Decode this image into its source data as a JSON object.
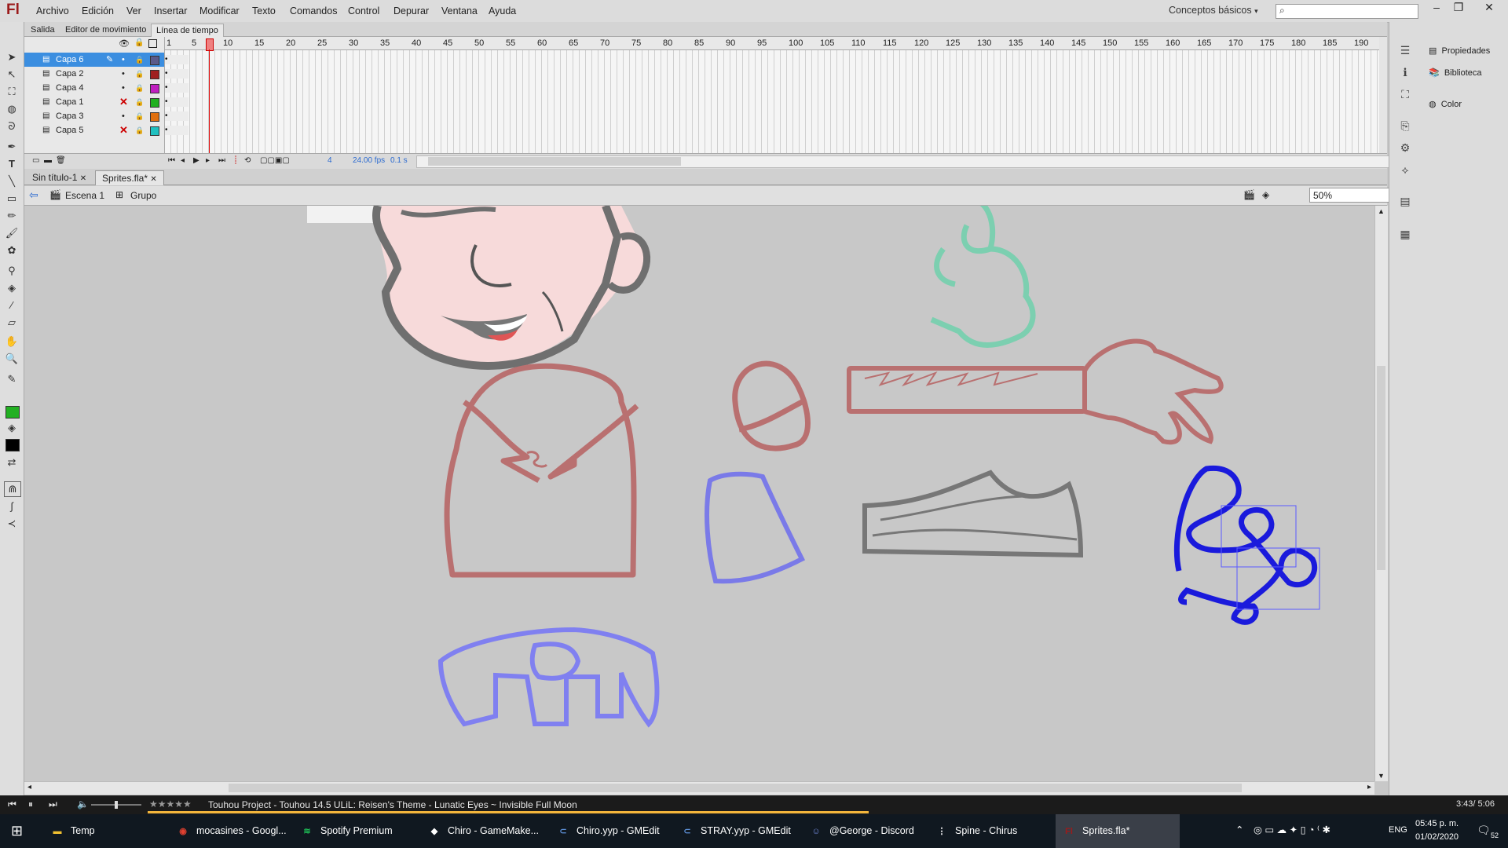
{
  "app": {
    "logo": "Fl",
    "menu": [
      "Archivo",
      "Edición",
      "Ver",
      "Insertar",
      "Modificar",
      "Texto",
      "Comandos",
      "Control",
      "Depurar",
      "Ventana",
      "Ayuda"
    ],
    "workspace": "Conceptos básicos",
    "search_placeholder": ""
  },
  "panel_tabs": [
    "Salida",
    "Editor de movimiento",
    "Línea de tiempo"
  ],
  "timeline": {
    "layers": [
      {
        "name": "Capa 6",
        "color": "#5a5a8a",
        "selected": true,
        "hidden": false
      },
      {
        "name": "Capa 2",
        "color": "#a02020",
        "selected": false,
        "hidden": false
      },
      {
        "name": "Capa 4",
        "color": "#c020c0",
        "selected": false,
        "hidden": false
      },
      {
        "name": "Capa 1",
        "color": "#20b020",
        "selected": false,
        "hidden": true
      },
      {
        "name": "Capa 3",
        "color": "#e07010",
        "selected": false,
        "hidden": false
      },
      {
        "name": "Capa 5",
        "color": "#20c0c0",
        "selected": false,
        "hidden": true
      }
    ],
    "frame_numbers": [
      "1",
      "5",
      "10",
      "15",
      "20",
      "25",
      "30",
      "35",
      "40",
      "45",
      "50",
      "55",
      "60",
      "65",
      "70",
      "75",
      "80",
      "85",
      "90",
      "95",
      "100",
      "105",
      "110",
      "115",
      "120",
      "125",
      "130",
      "135",
      "140",
      "145",
      "150",
      "155",
      "160",
      "165",
      "170",
      "175",
      "180",
      "185",
      "190"
    ],
    "current_frame": "4",
    "fps": "24.00 fps",
    "time": "0.1 s"
  },
  "doc_tabs": [
    "Sin título-1",
    "Sprites.fla*"
  ],
  "breadcrumb": [
    "Escena 1",
    "Grupo"
  ],
  "zoom": "50%",
  "right_panels": [
    "Propiedades",
    "Biblioteca",
    "Color"
  ],
  "media": {
    "rating": "★★★★★",
    "track": "Touhou Project - Touhou 14.5 ULiL: Reisen's Theme - Lunatic Eyes ~ Invisible Full Moon",
    "elapsed_total": "3:43/ 5:06",
    "progress": 0.73
  },
  "taskbar": {
    "items": [
      {
        "label": "Temp",
        "color": "#f0c030",
        "glyph": "▬"
      },
      {
        "label": "mocasines - Googl...",
        "color": "#e04030",
        "glyph": "◉"
      },
      {
        "label": "Spotify Premium",
        "color": "#1db954",
        "glyph": "≋"
      },
      {
        "label": "Chiro - GameMake...",
        "color": "#ffffff",
        "glyph": "◆"
      },
      {
        "label": "Chiro.yyp - GMEdit",
        "color": "#5c8fd6",
        "glyph": "⊂"
      },
      {
        "label": "STRAY.yyp - GMEdit",
        "color": "#5c8fd6",
        "glyph": "⊂"
      },
      {
        "label": "@George - Discord",
        "color": "#7289da",
        "glyph": "☺"
      },
      {
        "label": "Spine - Chirus",
        "color": "#ffffff",
        "glyph": "⋮"
      },
      {
        "label": "Sprites.fla*",
        "color": "#9b1b1b",
        "glyph": "Fl"
      }
    ],
    "language": "ENG",
    "time": "05:45 p. m.",
    "date": "01/02/2020",
    "notifications": "52"
  }
}
